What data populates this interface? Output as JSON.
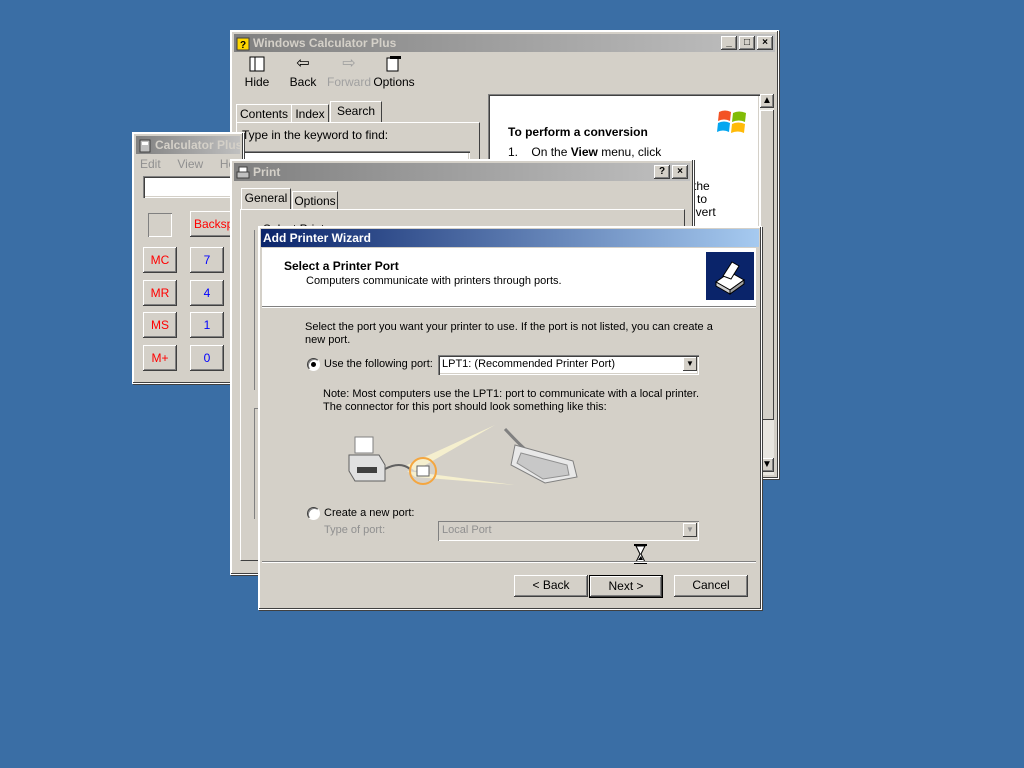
{
  "help_window": {
    "title": "Windows Calculator Plus",
    "toolbar": {
      "hide": "Hide",
      "back": "Back",
      "forward": "Forward",
      "options": "Options"
    },
    "tabs": [
      "Contents",
      "Index",
      "Search"
    ],
    "search_prompt": "Type in the keyword to find:",
    "content": {
      "heading": "To perform a conversion",
      "step_number": "1.",
      "step_pre": "On the ",
      "step_bold": "View",
      "step_post": " menu, click",
      "frag1": "the",
      "frag2": "to",
      "frag3": "nvert"
    }
  },
  "calc_window": {
    "title": "Calculator Plus",
    "menu": [
      "Edit",
      "View",
      "Help"
    ],
    "backspace": "Backsp",
    "memory_buttons": [
      "MC",
      "MR",
      "MS",
      "M+"
    ],
    "digit_buttons": [
      "7",
      "4",
      "1",
      "0"
    ]
  },
  "print_dialog": {
    "title": "Print",
    "tabs": [
      "General",
      "Options"
    ],
    "hidden_label": "Select Printer"
  },
  "wizard": {
    "title": "Add Printer Wizard",
    "header_title": "Select a Printer Port",
    "header_subtitle": "Computers communicate with printers through ports.",
    "instructions": "Select the port you want your printer to use.  If the port is not listed, you can create a new port.",
    "use_port_label": "Use the following port:",
    "use_port_value": "LPT1: (Recommended Printer Port)",
    "note": "Note: Most computers use the LPT1: port to communicate with a local printer. The connector for this port should look something like this:",
    "create_port_label": "Create a new port:",
    "type_of_port_label": "Type of port:",
    "type_of_port_value": "Local Port",
    "back_button": "< Back",
    "next_button": "Next >",
    "cancel_button": "Cancel"
  },
  "colors": {
    "desktop": "#3a6ea5",
    "active_title_start": "#0a246a",
    "active_title_end": "#a6caf0",
    "window_face": "#d4d0c8"
  }
}
